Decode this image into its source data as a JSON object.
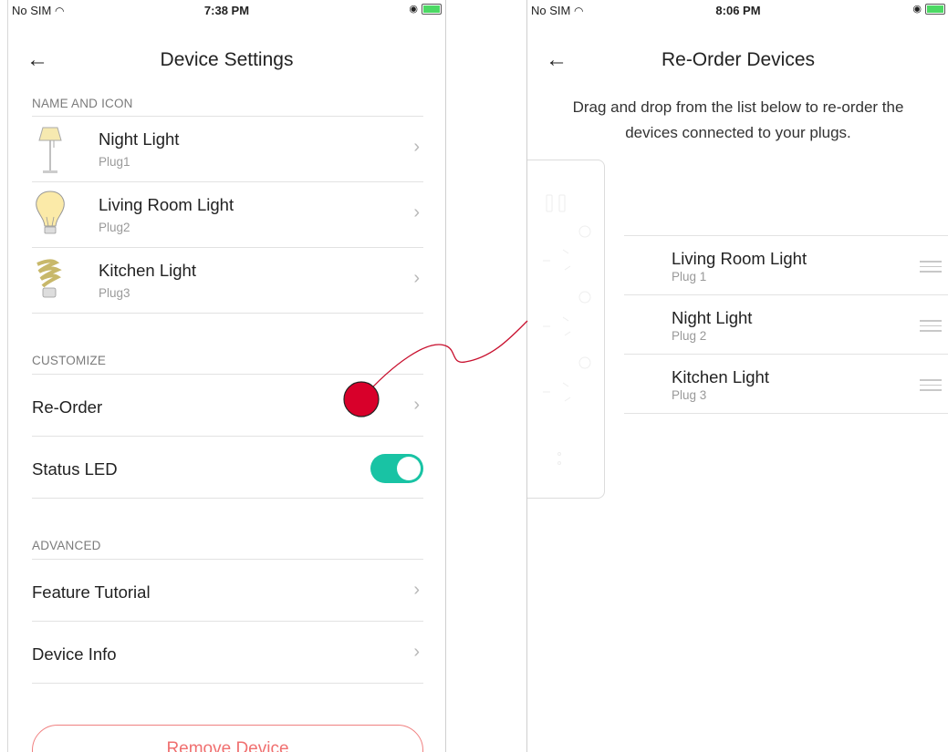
{
  "screen1": {
    "status": {
      "carrier": "No SIM",
      "time": "7:38 PM"
    },
    "nav": {
      "back_icon": "←",
      "title": "Device Settings"
    },
    "sections": {
      "name_icon": "NAME AND ICON",
      "customize": "CUSTOMIZE",
      "advanced": "ADVANCED"
    },
    "devices": [
      {
        "name": "Night Light",
        "plug": "Plug1",
        "icon": "floor-lamp-icon"
      },
      {
        "name": "Living Room Light",
        "plug": "Plug2",
        "icon": "bulb-icon"
      },
      {
        "name": "Kitchen Light",
        "plug": "Plug3",
        "icon": "cfl-bulb-icon"
      }
    ],
    "customize": {
      "reorder": "Re-Order",
      "status_led": "Status LED",
      "status_led_on": true
    },
    "advanced": {
      "tutorial": "Feature Tutorial",
      "device_info": "Device Info"
    },
    "remove_button": "Remove Device",
    "chevron": "›"
  },
  "screen2": {
    "status": {
      "carrier": "No SIM",
      "time": "8:06 PM"
    },
    "nav": {
      "back_icon": "←",
      "title": "Re-Order Devices"
    },
    "instructions_line1": "Drag and drop from the list below to re-order the",
    "instructions_line2": "devices connected to your plugs.",
    "devices": [
      {
        "name": "Living Room Light",
        "plug": "Plug 1"
      },
      {
        "name": "Night Light",
        "plug": "Plug 2"
      },
      {
        "name": "Kitchen Light",
        "plug": "Plug 3"
      }
    ]
  },
  "colors": {
    "accent": "#19c3a4",
    "danger": "#f07070",
    "marker": "#d8002a"
  }
}
